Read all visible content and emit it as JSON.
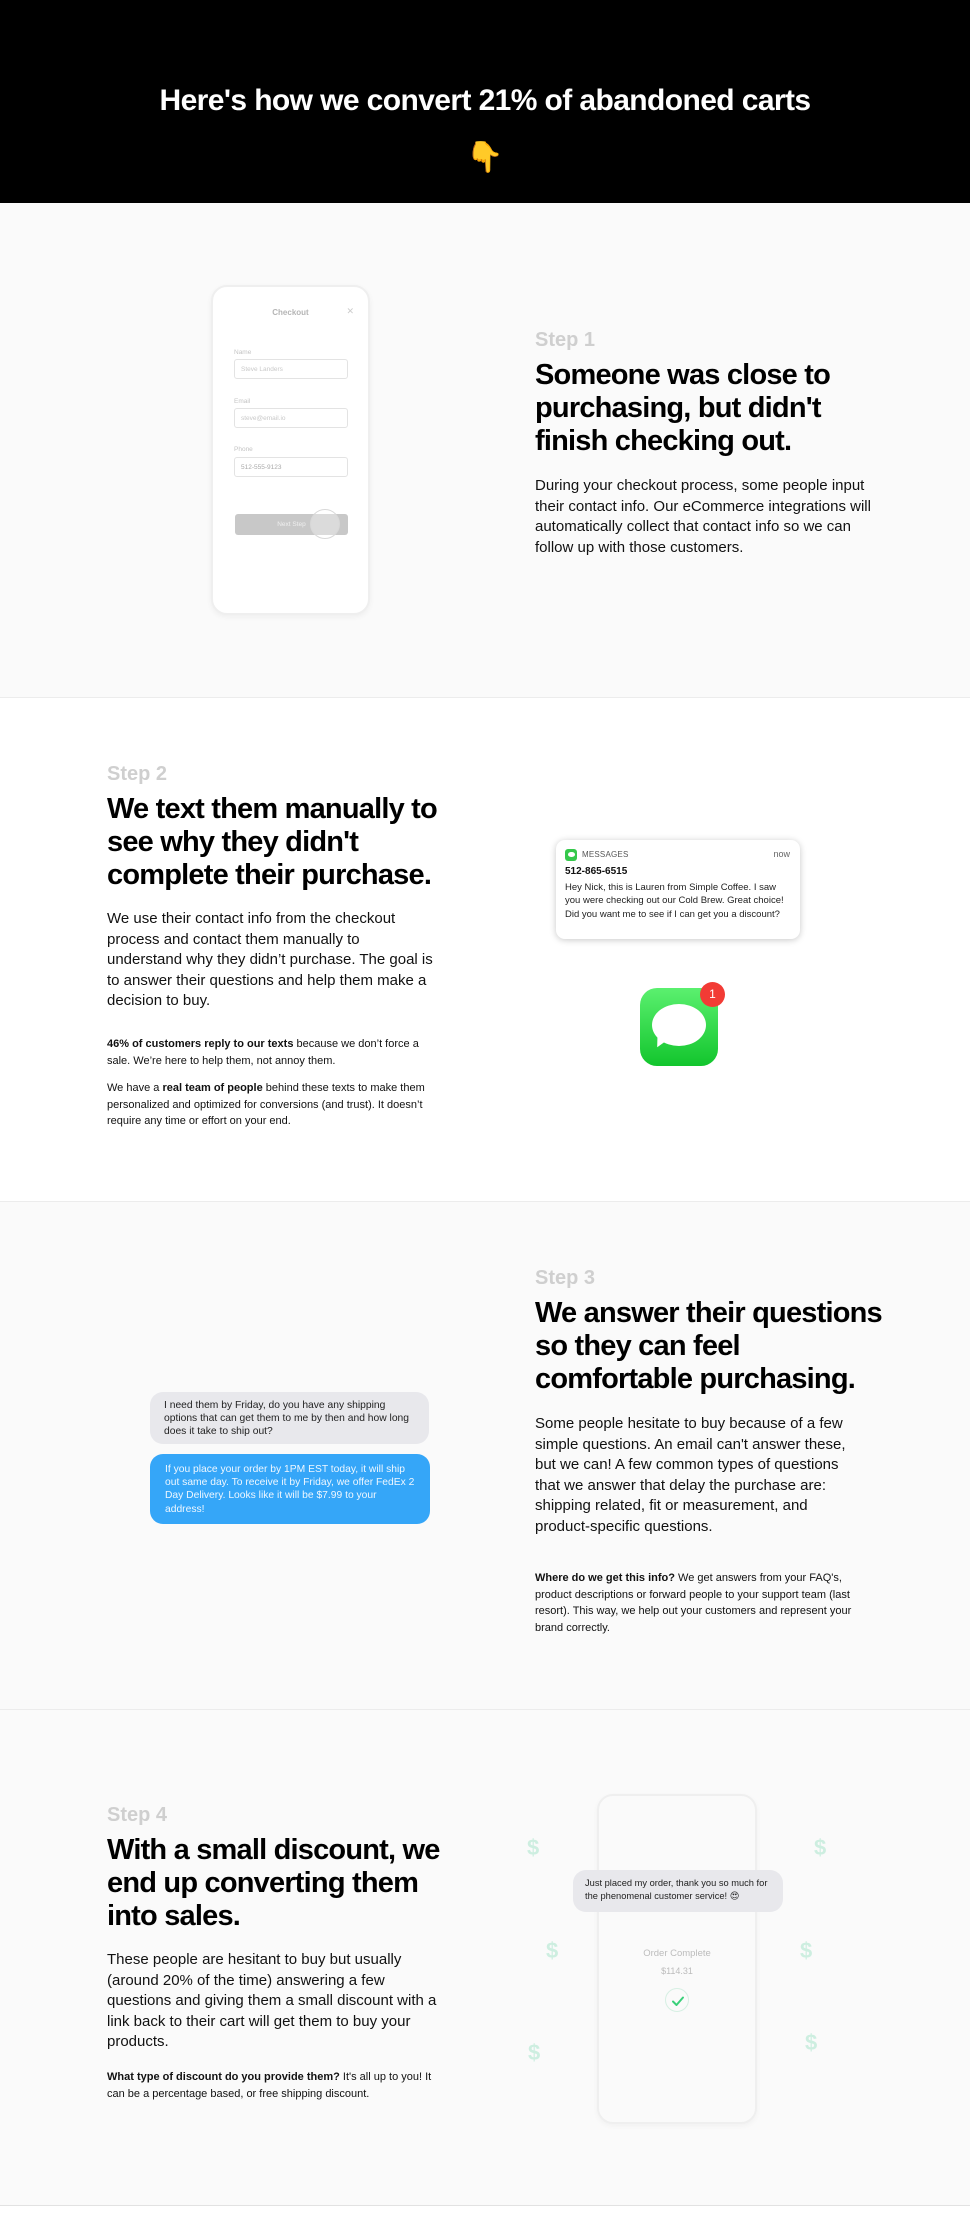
{
  "hero": {
    "title": "Here's how we convert 21% of abandoned carts",
    "emoji": "👇"
  },
  "step1": {
    "label": "Step 1",
    "title": "Someone was close to purchasing, but didn't finish checking out.",
    "body": "During your checkout process, some people input their contact info. Our eCommerce integrations will automatically collect that contact info so we can follow up with those customers.",
    "phone": {
      "title": "Checkout",
      "close": "✕",
      "name_label": "Name",
      "name_placeholder": "Steve Landers",
      "email_label": "Email",
      "email_placeholder": "steve@email.io",
      "phone_label": "Phone",
      "phone_value": "512-555-9123",
      "button": "Next Step"
    }
  },
  "step2": {
    "label": "Step 2",
    "title": "We text them manually to see why they didn't complete their purchase.",
    "body": "We use their contact info from the checkout process and contact them manually to understand why they didn’t purchase. The goal is to answer their questions and help them make a decision to buy.",
    "stat_bold": "46% of customers reply to our texts",
    "stat_rest": " because we don’t force a sale. We’re here to help them, not annoy them.",
    "team_pre": "We have a ",
    "team_bold": "real team of people",
    "team_rest": " behind these texts to make them personalized and optimized for conversions (and trust). It doesn’t require any time or effort on your end.",
    "notification": {
      "app": "MESSAGES",
      "time": "now",
      "from": "512-865-6515",
      "message": "Hey Nick, this is Lauren from Simple Coffee. I saw you were checking out our Cold Brew. Great choice! Did you want me to see if I can get you a discount?"
    },
    "badge": "1"
  },
  "step3": {
    "label": "Step 3",
    "title": "We answer their questions so they can feel comfortable purchasing.",
    "body": "Some people hesitate to buy because of a few simple questions. An email can't answer these, but we can! A few common types of questions that we answer that delay the purchase are: shipping related, fit or measurement, and product-specific questions.",
    "info_bold": "Where do we get this info?",
    "info_rest": " We get answers from your FAQ's, product descriptions or forward people to your support team (last resort). This way, we help out your customers and represent your brand correctly.",
    "chat_in": "I need them by Friday, do you have any shipping options that can get them to me by then and how long does it take to ship out?",
    "chat_out": "If you place your order by 1PM EST today, it will ship out same day. To receive it by Friday, we offer FedEx 2 Day Delivery. Looks like it will be $7.99 to your address!"
  },
  "step4": {
    "label": "Step 4",
    "title": "With a small discount, we end up converting them into sales.",
    "body": "These people are hesitant to buy but usually (around 20% of the time) answering a few questions and giving them a small discount with a link back to their cart will get them to buy your products.",
    "discount_bold": "What type of discount do you provide them?",
    "discount_rest": " It's all up to you! It can be a percentage based, or free shipping discount.",
    "chat": "Just placed my order, thank you so much for the phenomenal customer service! 😍",
    "order_status": "Order Complete",
    "order_total": "$114.31",
    "dollar": "$"
  },
  "colors": {
    "hero_bg": "#000000",
    "step_label": "#cfcfcf",
    "chat_blue": "#35a6f8",
    "chat_gray": "#e8e8ec",
    "messages_green": "#1ec935",
    "badge_red": "#f23b35",
    "dollar_mint": "#cdeee0"
  }
}
